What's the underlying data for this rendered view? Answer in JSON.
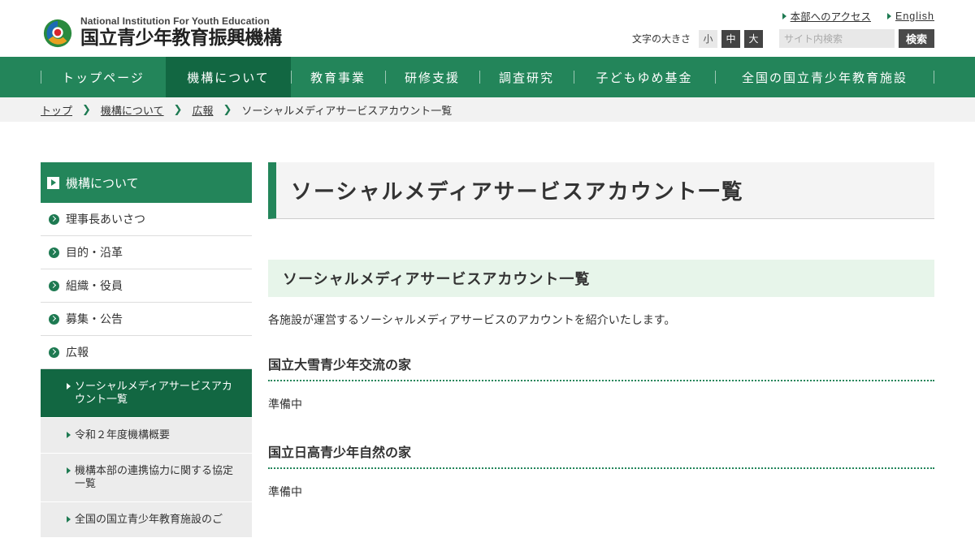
{
  "header": {
    "logo_en": "National Institution For Youth Education",
    "logo_ja": "国立青少年教育振興機構",
    "links": [
      {
        "label": "本部へのアクセス"
      },
      {
        "label": "English"
      }
    ],
    "font_size_label": "文字の大きさ",
    "font_sizes": [
      "小",
      "中",
      "大"
    ],
    "search_placeholder": "サイト内検索",
    "search_button": "検索"
  },
  "gnav": [
    {
      "label": "トップページ"
    },
    {
      "label": "機構について"
    },
    {
      "label": "教育事業"
    },
    {
      "label": "研修支援"
    },
    {
      "label": "調査研究"
    },
    {
      "label": "子どもゆめ基金"
    },
    {
      "label": "全国の国立青少年教育施設"
    }
  ],
  "breadcrumb": {
    "links": [
      "トップ",
      "機構について",
      "広報"
    ],
    "current": "ソーシャルメディアサービスアカウント一覧"
  },
  "sidebar": {
    "heading": "機構について",
    "items": [
      {
        "label": "理事長あいさつ"
      },
      {
        "label": "目的・沿革"
      },
      {
        "label": "組織・役員"
      },
      {
        "label": "募集・公告"
      },
      {
        "label": "広報"
      }
    ],
    "subitems": [
      {
        "label": "ソーシャルメディアサービスアカウント一覧"
      },
      {
        "label": "令和２年度機構概要"
      },
      {
        "label": "機構本部の連携協力に関する協定一覧"
      },
      {
        "label": "全国の国立青少年教育施設のご"
      }
    ]
  },
  "main": {
    "page_title": "ソーシャルメディアサービスアカウント一覧",
    "section_title": "ソーシャルメディアサービスアカウント一覧",
    "intro": "各施設が運営するソーシャルメディアサービスのアカウントを紹介いたします。",
    "facilities": [
      {
        "name": "国立大雪青少年交流の家",
        "status": "準備中"
      },
      {
        "name": "国立日高青少年自然の家",
        "status": "準備中"
      }
    ]
  },
  "colors": {
    "brand_green": "#23855a",
    "active_green": "#126742",
    "section_bg": "#e7f5ea"
  }
}
